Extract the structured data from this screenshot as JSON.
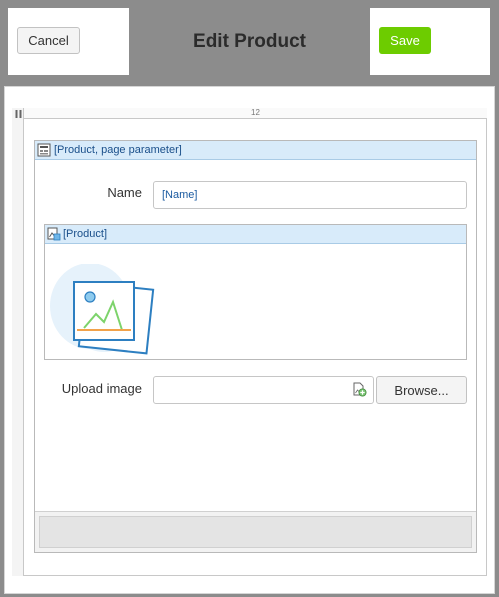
{
  "header": {
    "title": "Edit Product",
    "cancel_label": "Cancel",
    "save_label": "Save"
  },
  "grid": {
    "column_span": "12"
  },
  "form": {
    "header_label": "[Product, page parameter]",
    "name_label": "Name",
    "name_value": "[Name]",
    "image_header_label": "[Product]",
    "upload_label": "Upload image",
    "browse_label": "Browse..."
  },
  "colors": {
    "save_button": "#6dcc00",
    "panel_header": "#d8ebfa",
    "header_bar": "#8c8c8c"
  },
  "icons": {
    "grid_handle": "drag-handle-icon",
    "form_header": "form-icon",
    "image_header": "image-editor-icon",
    "image_placeholder": "image-placeholder-icon",
    "upload": "file-upload-icon"
  }
}
